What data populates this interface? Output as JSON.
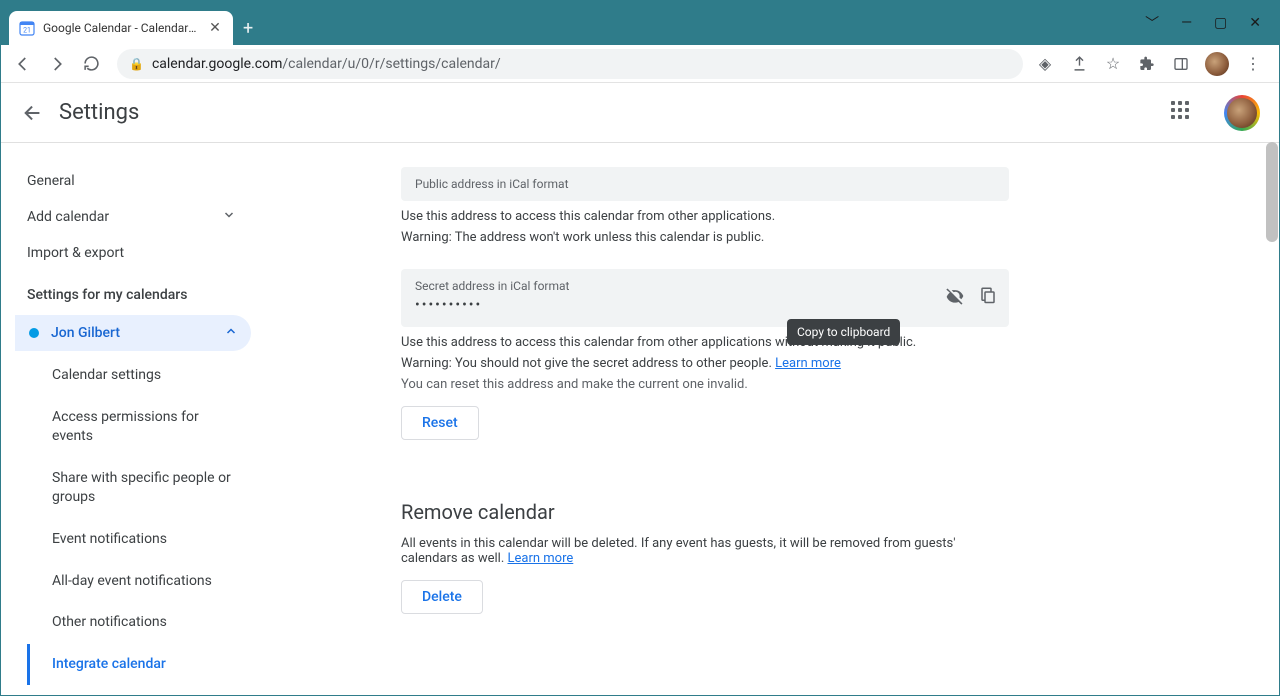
{
  "browser": {
    "tab_title": "Google Calendar - Calendar setti",
    "url_domain": "calendar.google.com",
    "url_path": "/calendar/u/0/r/settings/calendar/"
  },
  "header": {
    "title": "Settings"
  },
  "sidebar": {
    "general": "General",
    "add_calendar": "Add calendar",
    "import_export": "Import & export",
    "section_heading": "Settings for my calendars",
    "calendar_name": "Jon Gilbert",
    "sub": {
      "settings": "Calendar settings",
      "access": "Access permissions for events",
      "share": "Share with specific people or groups",
      "event_notif": "Event notifications",
      "allday_notif": "All-day event notifications",
      "other_notif": "Other notifications",
      "integrate": "Integrate calendar"
    }
  },
  "main": {
    "public": {
      "label": "Public address in iCal format",
      "hint1": "Use this address to access this calendar from other applications.",
      "hint2": "Warning: The address won't work unless this calendar is public."
    },
    "secret": {
      "label": "Secret address in iCal format",
      "value": "••••••••••",
      "hint1": "Use this address to access this calendar from other applications without making it public.",
      "hint2_prefix": "Warning: You should not give the secret address to other people. ",
      "learn_more": "Learn more",
      "hint3": "You can reset this address and make the current one invalid.",
      "reset": "Reset"
    },
    "remove": {
      "title": "Remove calendar",
      "desc_prefix": "All events in this calendar will be deleted. If any event has guests, it will be removed from guests' calendars as well. ",
      "learn_more": "Learn more",
      "delete": "Delete"
    },
    "tooltip": "Copy to clipboard"
  }
}
